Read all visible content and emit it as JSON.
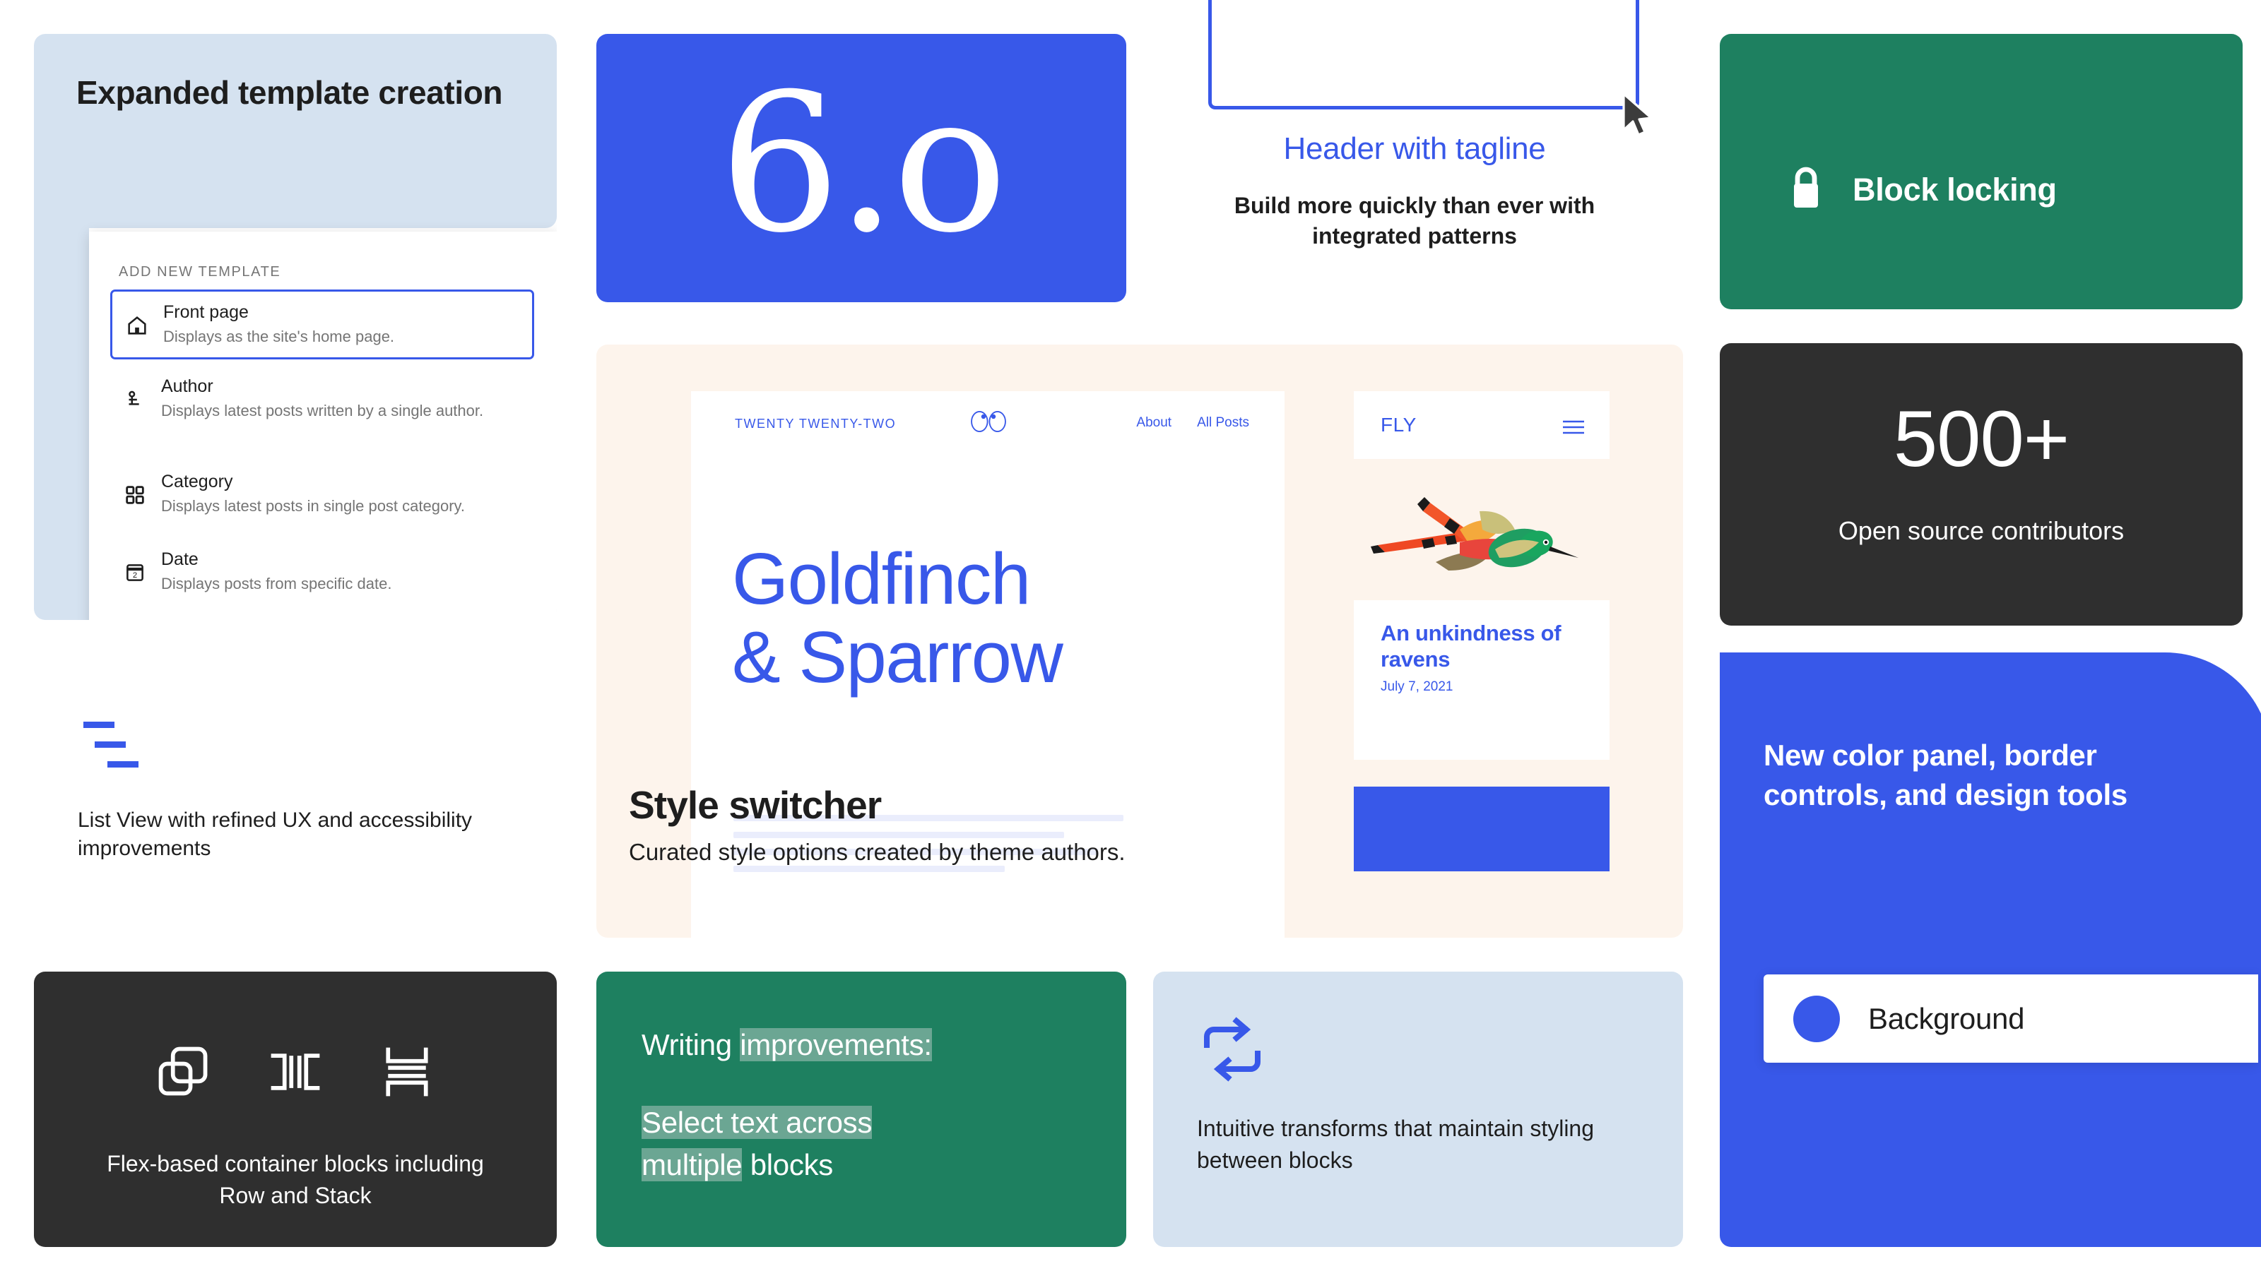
{
  "template_card": {
    "title": "Expanded template creation",
    "panel_heading": "ADD NEW TEMPLATE",
    "items": [
      {
        "icon": "home-icon",
        "name": "Front page",
        "desc": "Displays as the site's home page.",
        "selected": true
      },
      {
        "icon": "author-icon",
        "name": "Author",
        "desc": "Displays latest posts written by a single author.",
        "selected": false
      },
      {
        "icon": "category-icon",
        "name": "Category",
        "desc": "Displays latest posts in single post category.",
        "selected": false
      },
      {
        "icon": "date-icon",
        "name": "Date",
        "desc": "Displays posts from specific date.",
        "selected": false
      }
    ]
  },
  "version_card": {
    "number": "6.o"
  },
  "header_card": {
    "title": "Header with tagline",
    "subtitle": "Build more quickly than ever with integrated patterns",
    "cursor_icon": "mouse-cursor-icon"
  },
  "block_locking_card": {
    "label": "Block locking",
    "icon": "lock-icon"
  },
  "stat_card": {
    "number": "500+",
    "label": "Open source contributors"
  },
  "theme_card": {
    "browser": {
      "brand": "TWENTY TWENTY-TWO",
      "logo_icon": "bird-eyes-logo-icon",
      "nav": [
        "About",
        "All Posts"
      ],
      "heading_line1": "Goldfinch",
      "heading_line2": "& Sparrow"
    },
    "style_switcher": {
      "title": "Style switcher",
      "subtitle": "Curated style options created by theme authors."
    },
    "phone": {
      "brand": "FLY",
      "menu_icon": "hamburger-menu-icon",
      "image_alt": "hummingbird-illustration",
      "post_title": "An unkindness of ravens",
      "post_date": "July 7, 2021"
    }
  },
  "list_view_card": {
    "icon": "list-view-icon",
    "text": "List View with refined UX and accessibility improvements"
  },
  "flex_card": {
    "icons": [
      "group-blocks-icon",
      "row-block-icon",
      "stack-block-icon"
    ],
    "text": "Flex-based container blocks including Row and Stack"
  },
  "writing_card": {
    "line1_plain": "Writing ",
    "line1_selected": "improvements:",
    "line2_selected_a": "Select text across",
    "line2_selected_b": "multiple",
    "line2_plain": " blocks"
  },
  "transforms_card": {
    "icon": "transform-arrows-icon",
    "text": "Intuitive transforms that maintain styling between blocks"
  },
  "color_panel_card": {
    "title": "New color panel, border controls, and design tools",
    "swatch_label": "Background",
    "swatch_icon": "color-swatch-icon"
  },
  "colors": {
    "blue": "#3858e9",
    "light_blue": "#d5e2f0",
    "green": "#1e8060",
    "dark": "#2f2f2f",
    "cream": "#fdf4ec",
    "selection_green": "#6ba693"
  }
}
